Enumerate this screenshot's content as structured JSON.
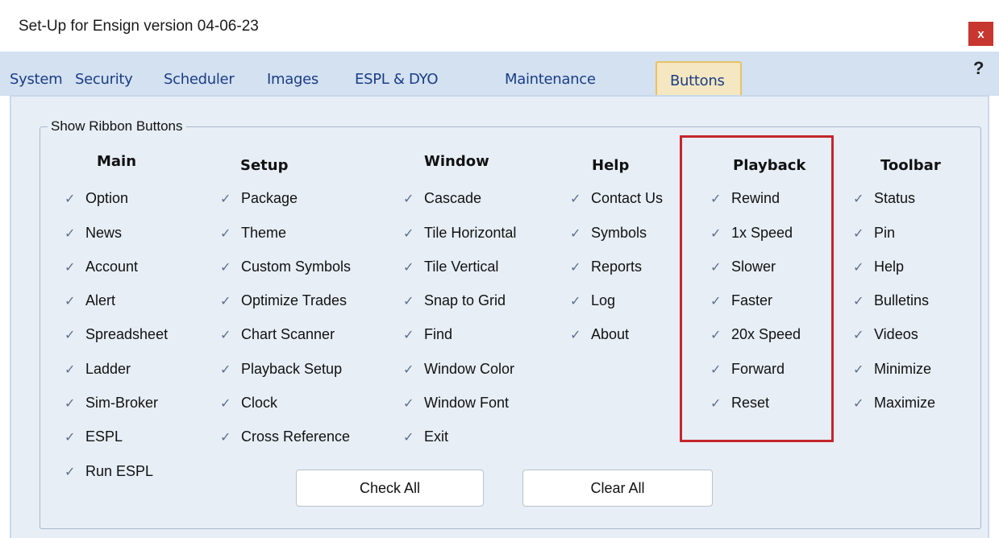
{
  "window": {
    "title": "Set-Up for Ensign version 04-06-23",
    "close_label": "x",
    "help_label": "?"
  },
  "tabs": [
    "System",
    "Security",
    "Scheduler",
    "Images",
    "ESPL & DYO",
    "Maintenance",
    "Buttons"
  ],
  "active_tab": "Buttons",
  "group_title": "Show Ribbon Buttons",
  "check_glyph": "✓",
  "columns": {
    "main": {
      "header": "Main",
      "items": [
        "Option",
        "News",
        "Account",
        "Alert",
        "Spreadsheet",
        "Ladder",
        "Sim-Broker",
        "ESPL",
        "Run ESPL"
      ]
    },
    "setup": {
      "header": "Setup",
      "items": [
        "Package",
        "Theme",
        "Custom Symbols",
        "Optimize Trades",
        "Chart Scanner",
        "Playback Setup",
        "Clock",
        "Cross Reference"
      ]
    },
    "window": {
      "header": "Window",
      "items": [
        "Cascade",
        "Tile Horizontal",
        "Tile Vertical",
        "Snap to Grid",
        "Find",
        "Window Color",
        "Window Font",
        "Exit"
      ]
    },
    "help": {
      "header": "Help",
      "items": [
        "Contact Us",
        "Symbols",
        "Reports",
        "Log",
        "About"
      ]
    },
    "playback": {
      "header": "Playback",
      "items": [
        "Rewind",
        "1x Speed",
        "Slower",
        "Faster",
        "20x Speed",
        "Forward",
        "Reset"
      ]
    },
    "toolbar": {
      "header": "Toolbar",
      "items": [
        "Status",
        "Pin",
        "Help",
        "Bulletins",
        "Videos",
        "Minimize",
        "Maximize"
      ]
    }
  },
  "buttons": {
    "check_all": "Check All",
    "clear_all": "Clear All"
  },
  "colors": {
    "highlight_box": "#c4262a",
    "active_tab_bg": "#f4e7c1",
    "tab_text": "#1b3d85",
    "panel_bg": "#e7eef6"
  }
}
